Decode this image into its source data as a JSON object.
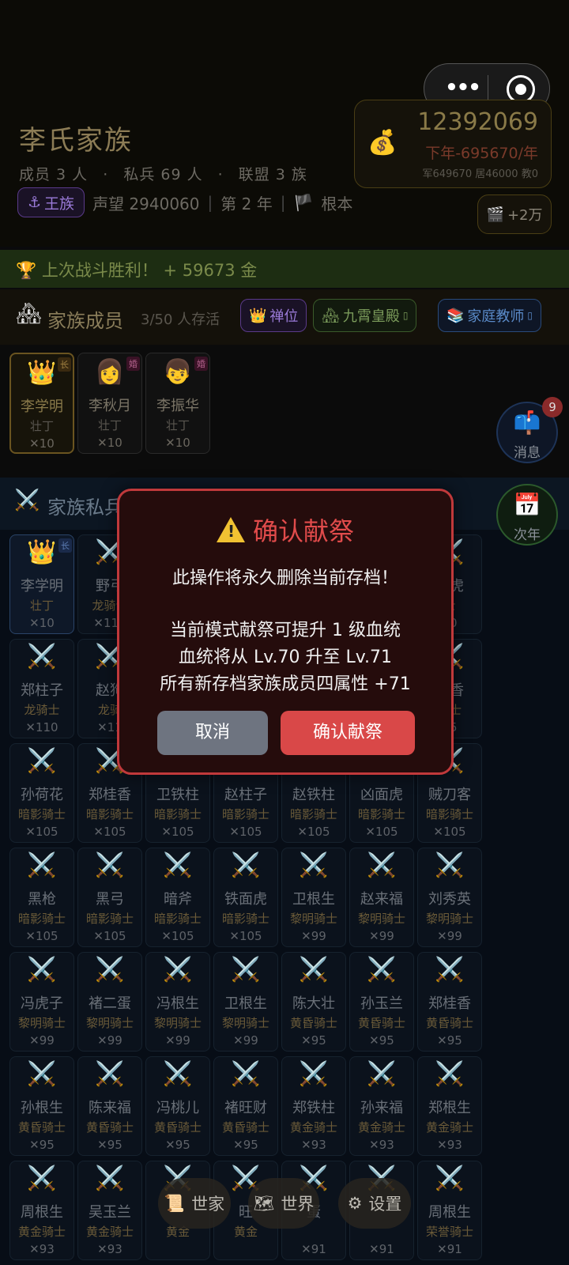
{
  "capsule": {
    "more": "•••"
  },
  "header": {
    "family_name": "李氏家族",
    "members_label": "成员 3 人",
    "soldiers_label": "私兵 69 人",
    "alliance_label": "联盟 3 族",
    "dot": "·",
    "royal_badge": "王族",
    "prestige": "声望 2940060",
    "year": "第 2 年",
    "root": "根本",
    "sep": "|"
  },
  "money": {
    "amount": "12392069",
    "rate": "下年-695670/年",
    "detail": "军649670 居46000 教0",
    "ad_label": "+2万"
  },
  "victory": {
    "text": "上次战斗胜利！ + 59673 金"
  },
  "members_section": {
    "title": "家族成员",
    "subtitle": "3/50 人存活",
    "pill_abdicate": "禅位",
    "pill_palace": "九霄皇殿",
    "pill_teacher": "家庭教师",
    "cards": [
      {
        "icon": "👑",
        "name": "李学明",
        "rank": "壮丁",
        "power": "✕10",
        "tag": "长"
      },
      {
        "icon": "👩",
        "name": "李秋月",
        "rank": "壮丁",
        "power": "✕10",
        "tag": "婚"
      },
      {
        "icon": "👦",
        "name": "李振华",
        "rank": "壮丁",
        "power": "✕10",
        "tag": "婚"
      }
    ]
  },
  "soldiers_section": {
    "title": "家族私兵",
    "rows": [
      [
        {
          "name": "李学明",
          "rank": "壮丁",
          "power": "✕10",
          "lead": true,
          "tag": "长"
        },
        {
          "name": "野弓",
          "rank": "龙骑士",
          "power": "✕110"
        },
        {
          "name": "",
          "rank": "",
          "power": ""
        },
        {
          "name": "",
          "rank": "",
          "power": ""
        },
        {
          "name": "",
          "rank": "",
          "power": ""
        },
        {
          "name": "",
          "rank": "",
          "power": ""
        },
        {
          "name": "面虎",
          "rank": "士",
          "power": "10"
        }
      ],
      [
        {
          "name": "郑柱子",
          "rank": "龙骑士",
          "power": "✕110"
        },
        {
          "name": "赵狗",
          "rank": "龙骑",
          "power": "✕11"
        },
        {
          "name": "",
          "rank": "",
          "power": ""
        },
        {
          "name": "",
          "rank": "",
          "power": ""
        },
        {
          "name": "",
          "rank": "",
          "power": ""
        },
        {
          "name": "",
          "rank": "",
          "power": ""
        },
        {
          "name": "桂香",
          "rank": "骑士",
          "power": "05"
        }
      ],
      [
        {
          "name": "孙荷花",
          "rank": "暗影骑士",
          "power": "✕105"
        },
        {
          "name": "郑桂香",
          "rank": "暗影骑士",
          "power": "✕105"
        },
        {
          "name": "卫铁柱",
          "rank": "暗影骑士",
          "power": "✕105"
        },
        {
          "name": "赵柱子",
          "rank": "暗影骑士",
          "power": "✕105"
        },
        {
          "name": "赵铁柱",
          "rank": "暗影骑士",
          "power": "✕105"
        },
        {
          "name": "凶面虎",
          "rank": "暗影骑士",
          "power": "✕105"
        },
        {
          "name": "贼刀客",
          "rank": "暗影骑士",
          "power": "✕105"
        }
      ],
      [
        {
          "name": "黑枪",
          "rank": "暗影骑士",
          "power": "✕105"
        },
        {
          "name": "黑弓",
          "rank": "暗影骑士",
          "power": "✕105"
        },
        {
          "name": "暗斧",
          "rank": "暗影骑士",
          "power": "✕105"
        },
        {
          "name": "铁面虎",
          "rank": "暗影骑士",
          "power": "✕105"
        },
        {
          "name": "卫根生",
          "rank": "黎明骑士",
          "power": "✕99"
        },
        {
          "name": "赵来福",
          "rank": "黎明骑士",
          "power": "✕99"
        },
        {
          "name": "刘秀英",
          "rank": "黎明骑士",
          "power": "✕99"
        }
      ],
      [
        {
          "name": "冯虎子",
          "rank": "黎明骑士",
          "power": "✕99"
        },
        {
          "name": "褚二蛋",
          "rank": "黎明骑士",
          "power": "✕99"
        },
        {
          "name": "冯根生",
          "rank": "黎明骑士",
          "power": "✕99"
        },
        {
          "name": "卫根生",
          "rank": "黎明骑士",
          "power": "✕99"
        },
        {
          "name": "陈大壮",
          "rank": "黄昏骑士",
          "power": "✕95"
        },
        {
          "name": "孙玉兰",
          "rank": "黄昏骑士",
          "power": "✕95"
        },
        {
          "name": "郑桂香",
          "rank": "黄昏骑士",
          "power": "✕95"
        }
      ],
      [
        {
          "name": "孙根生",
          "rank": "黄昏骑士",
          "power": "✕95"
        },
        {
          "name": "陈来福",
          "rank": "黄昏骑士",
          "power": "✕95"
        },
        {
          "name": "冯桃儿",
          "rank": "黄昏骑士",
          "power": "✕95"
        },
        {
          "name": "褚旺财",
          "rank": "黄昏骑士",
          "power": "✕95"
        },
        {
          "name": "郑铁柱",
          "rank": "黄金骑士",
          "power": "✕93"
        },
        {
          "name": "孙来福",
          "rank": "黄金骑士",
          "power": "✕93"
        },
        {
          "name": "郑根生",
          "rank": "黄金骑士",
          "power": "✕93"
        }
      ],
      [
        {
          "name": "周根生",
          "rank": "黄金骑士",
          "power": "✕93"
        },
        {
          "name": "吴玉兰",
          "rank": "黄金骑士",
          "power": "✕93"
        },
        {
          "name": "",
          "rank": "黄金",
          "power": ""
        },
        {
          "name": "旺",
          "rank": "黄金",
          "power": ""
        },
        {
          "name": "蛋",
          "rank": "",
          "power": "✕91"
        },
        {
          "name": "",
          "rank": "",
          "power": "✕91"
        },
        {
          "name": "周根生",
          "rank": "荣誉骑士",
          "power": "✕91"
        }
      ]
    ]
  },
  "floating": {
    "messages_label": "消息",
    "messages_count": "9",
    "next_year_label": "次年",
    "calendar_day": "17"
  },
  "dialog": {
    "title": "确认献祭",
    "line1": "此操作将永久删除当前存档！",
    "line2": "当前模式献祭可提升 1 级血统",
    "line3": "血统将从 Lv.70 升至 Lv.71",
    "line4": "所有新存档家族成员四属性 +71",
    "cancel": "取消",
    "confirm": "确认献祭"
  },
  "nav": {
    "family": "世家",
    "world": "世界",
    "settings": "设置"
  }
}
